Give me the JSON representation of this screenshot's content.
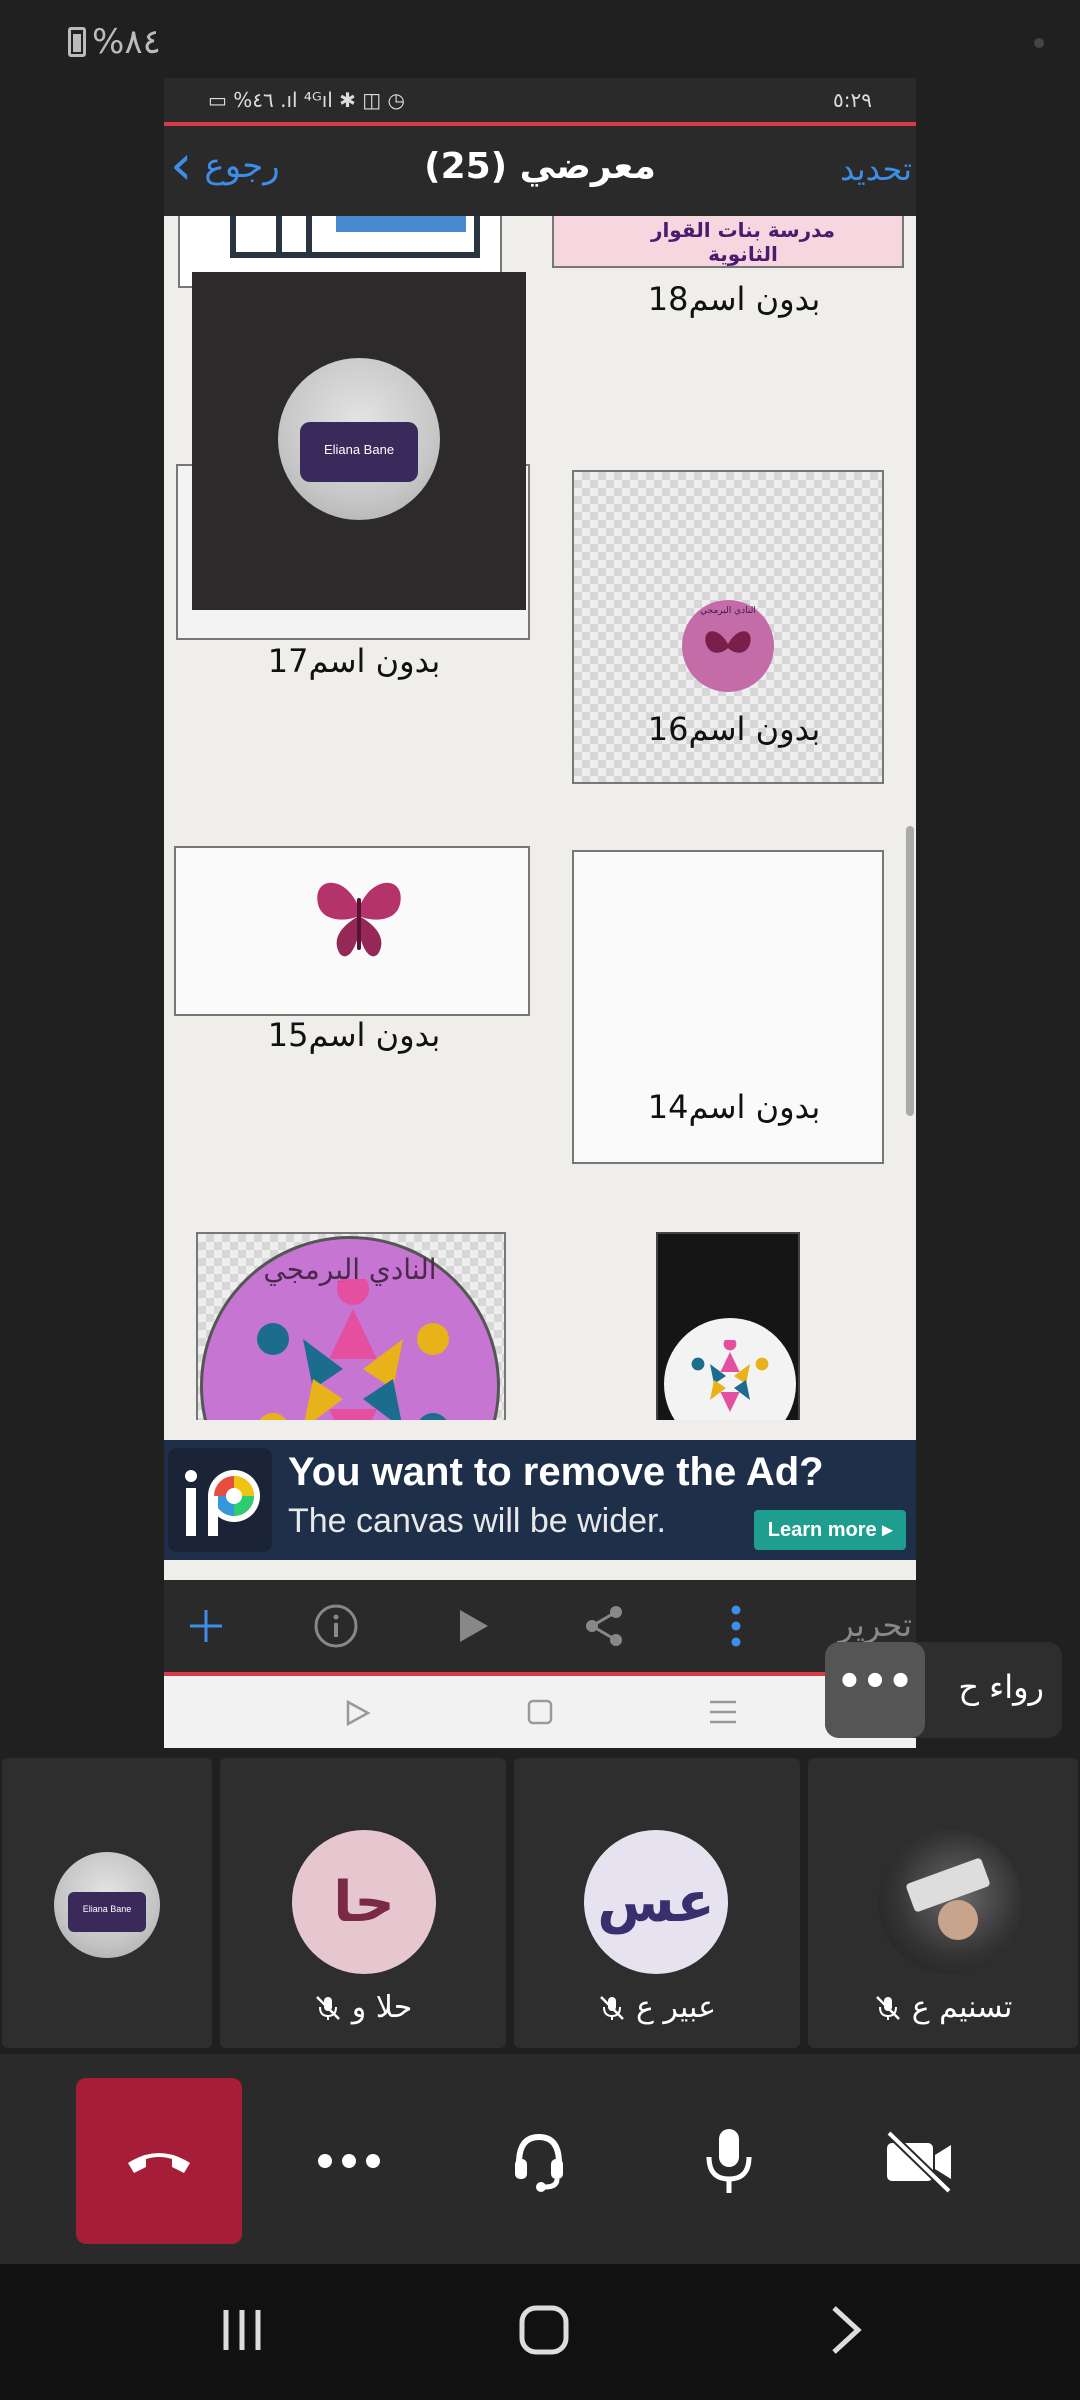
{
  "status_bar": {
    "battery_text": "%٨٤"
  },
  "shared_screen": {
    "status_left": "▭ %٤٦ .ıl ⁴ᴳıl ✱ ◫ ◷",
    "status_time": "٥:٢٩",
    "header": {
      "back_label": "رجوع",
      "title": "معرضي (25)",
      "update_label": "تحديد"
    },
    "gallery": {
      "top_banner_text": "مدرسة بنات القوار الثانوية",
      "items": [
        {
          "caption": "بدون اسم18"
        },
        {
          "caption": "بدون اسم17",
          "avatar_text": "Eliana Bane"
        },
        {
          "caption": "بدون اسم16",
          "logo_text": "النادي البرمجي"
        },
        {
          "caption": "بدون اسم15"
        },
        {
          "caption": "بدون اسم14"
        },
        {
          "logo_text": "النادي البرمجي"
        }
      ]
    },
    "ad": {
      "title": "You want to remove the Ad?",
      "subtitle": "The canvas will be wider.",
      "learn_more": "Learn more ▸"
    },
    "toolbar": {
      "edit_label": "تحرير"
    }
  },
  "speaker_pill": {
    "name": "رواء ح",
    "more": "•••"
  },
  "participants": [
    {
      "name": "",
      "avatar_text": "Eliana Bane"
    },
    {
      "name": "حلا و",
      "initials": "حا",
      "avatar_color": "#e6c7cf",
      "text_color": "#7a2a44"
    },
    {
      "name": "عبير ع",
      "initials": "عس",
      "avatar_color": "#e6e2f0",
      "text_color": "#3a2f6e"
    },
    {
      "name": "تسنيم ع"
    }
  ],
  "colors": {
    "accent_blue": "#3d8ee8",
    "hangup": "#a61d38",
    "redline": "#d83a4a"
  }
}
